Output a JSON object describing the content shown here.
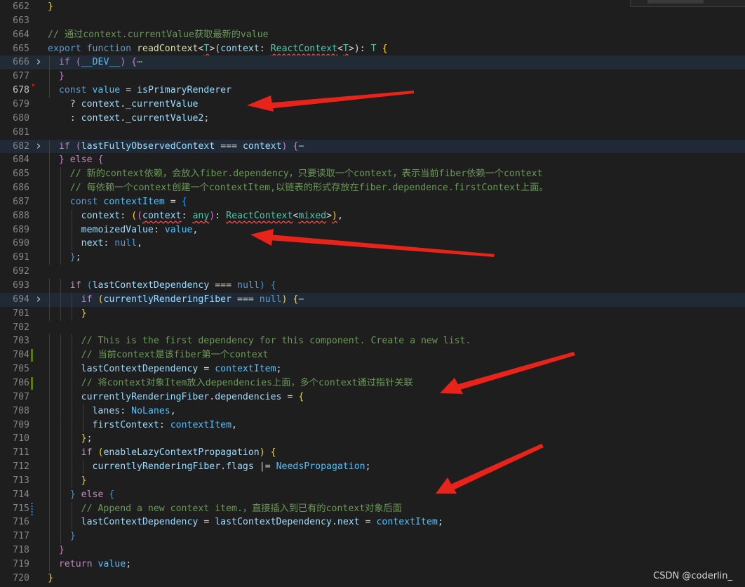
{
  "editor": {
    "lines": [
      {
        "n": "662",
        "tokens": [
          [
            "b1",
            "}"
          ]
        ]
      },
      {
        "n": "663",
        "tokens": []
      },
      {
        "n": "664",
        "tokens": [
          [
            "cmt",
            "// 通过context.currentValue获取最新的value"
          ]
        ]
      },
      {
        "n": "665",
        "tokens": [
          [
            "kw",
            "export"
          ],
          [
            "p",
            " "
          ],
          [
            "kw",
            "function"
          ],
          [
            "p",
            " "
          ],
          [
            "fn",
            "readContext"
          ],
          [
            "p",
            "<"
          ],
          [
            "type",
            "T",
            true
          ],
          [
            "p",
            ">("
          ],
          [
            "var",
            "context"
          ],
          [
            "p",
            ": "
          ],
          [
            "type",
            "ReactContext",
            true
          ],
          [
            "p",
            "<"
          ],
          [
            "type",
            "T",
            true
          ],
          [
            "p",
            ">)"
          ],
          [
            "p",
            ": "
          ],
          [
            "type",
            "T"
          ],
          [
            "p",
            " "
          ],
          [
            "b1",
            "{"
          ]
        ]
      },
      {
        "n": "666",
        "fold": ">",
        "tokens": [
          [
            "p",
            "  "
          ],
          [
            "ctl",
            "if"
          ],
          [
            "p",
            " "
          ],
          [
            "b2",
            "("
          ],
          [
            "const",
            "__DEV__"
          ],
          [
            "b2",
            ")"
          ],
          [
            "p",
            " "
          ],
          [
            "b2",
            "{"
          ],
          [
            "ell",
            "⋯"
          ]
        ]
      },
      {
        "n": "677",
        "tokens": [
          [
            "p",
            "  "
          ],
          [
            "b2",
            "}"
          ]
        ]
      },
      {
        "n": "678",
        "active": true,
        "gutter": "err",
        "tokens": [
          [
            "p",
            "  "
          ],
          [
            "kw",
            "const"
          ],
          [
            "p",
            " "
          ],
          [
            "const",
            "value"
          ],
          [
            "p",
            " = "
          ],
          [
            "var",
            "isPrimaryRenderer"
          ]
        ]
      },
      {
        "n": "679",
        "tokens": [
          [
            "p",
            "    ? "
          ],
          [
            "var",
            "context"
          ],
          [
            "p",
            "."
          ],
          [
            "var",
            "_currentValue"
          ]
        ]
      },
      {
        "n": "680",
        "tokens": [
          [
            "p",
            "    : "
          ],
          [
            "var",
            "context"
          ],
          [
            "p",
            "."
          ],
          [
            "var",
            "_currentValue2"
          ],
          [
            "p",
            ";"
          ]
        ]
      },
      {
        "n": "681",
        "tokens": []
      },
      {
        "n": "682",
        "fold": ">",
        "folded": true,
        "tokens": [
          [
            "p",
            "  "
          ],
          [
            "ctl",
            "if"
          ],
          [
            "p",
            " "
          ],
          [
            "b2",
            "("
          ],
          [
            "var",
            "lastFullyObservedContext"
          ],
          [
            "p",
            " === "
          ],
          [
            "var",
            "context"
          ],
          [
            "b2",
            ")"
          ],
          [
            "p",
            " "
          ],
          [
            "b2",
            "{"
          ],
          [
            "ell",
            "⋯"
          ]
        ]
      },
      {
        "n": "684",
        "tokens": [
          [
            "p",
            "  "
          ],
          [
            "b2",
            "}"
          ],
          [
            "p",
            " "
          ],
          [
            "ctl",
            "else"
          ],
          [
            "p",
            " "
          ],
          [
            "b2",
            "{"
          ]
        ]
      },
      {
        "n": "685",
        "tokens": [
          [
            "p",
            "    "
          ],
          [
            "cmt",
            "// 新的context依赖，会放入fiber.dependency，只要读取一个context，表示当前fiber依赖一个context"
          ]
        ]
      },
      {
        "n": "686",
        "tokens": [
          [
            "p",
            "    "
          ],
          [
            "cmt",
            "// 每依赖一个context创建一个contextItem,以链表的形式存放在fiber.dependence.firstContext上面。"
          ]
        ]
      },
      {
        "n": "687",
        "tokens": [
          [
            "p",
            "    "
          ],
          [
            "kw",
            "const"
          ],
          [
            "p",
            " "
          ],
          [
            "const",
            "contextItem"
          ],
          [
            "p",
            " = "
          ],
          [
            "b3",
            "{"
          ]
        ]
      },
      {
        "n": "688",
        "tokens": [
          [
            "p",
            "      "
          ],
          [
            "var",
            "context"
          ],
          [
            "p",
            ": "
          ],
          [
            "b1",
            "("
          ],
          [
            "b2",
            "("
          ],
          [
            "var",
            "context",
            true
          ],
          [
            "p",
            ": "
          ],
          [
            "type",
            "any",
            true
          ],
          [
            "b2",
            ")"
          ],
          [
            "p",
            ": "
          ],
          [
            "type",
            "ReactContext",
            true
          ],
          [
            "p",
            "<"
          ],
          [
            "type",
            "mixed",
            true
          ],
          [
            "p",
            ">"
          ],
          [
            "b1",
            ")",
            true
          ],
          [
            "p",
            ","
          ]
        ]
      },
      {
        "n": "689",
        "tokens": [
          [
            "p",
            "      "
          ],
          [
            "var",
            "memoizedValue"
          ],
          [
            "p",
            ": "
          ],
          [
            "const",
            "value"
          ],
          [
            "p",
            ","
          ]
        ]
      },
      {
        "n": "690",
        "tokens": [
          [
            "p",
            "      "
          ],
          [
            "var",
            "next"
          ],
          [
            "p",
            ": "
          ],
          [
            "kw",
            "null"
          ],
          [
            "p",
            ","
          ]
        ]
      },
      {
        "n": "691",
        "tokens": [
          [
            "p",
            "    "
          ],
          [
            "b3",
            "}"
          ],
          [
            "p",
            ";"
          ]
        ]
      },
      {
        "n": "692",
        "tokens": []
      },
      {
        "n": "693",
        "tokens": [
          [
            "p",
            "    "
          ],
          [
            "ctl",
            "if"
          ],
          [
            "p",
            " "
          ],
          [
            "b3",
            "("
          ],
          [
            "var",
            "lastContextDependency"
          ],
          [
            "p",
            " === "
          ],
          [
            "kw",
            "null"
          ],
          [
            "b3",
            ")"
          ],
          [
            "p",
            " "
          ],
          [
            "b3",
            "{"
          ]
        ]
      },
      {
        "n": "694",
        "fold": ">",
        "folded": true,
        "tokens": [
          [
            "p",
            "      "
          ],
          [
            "ctl",
            "if"
          ],
          [
            "p",
            " "
          ],
          [
            "b1",
            "("
          ],
          [
            "var",
            "currentlyRenderingFiber"
          ],
          [
            "p",
            " === "
          ],
          [
            "kw",
            "null"
          ],
          [
            "b1",
            ")"
          ],
          [
            "p",
            " "
          ],
          [
            "b1",
            "{"
          ],
          [
            "ell",
            "⋯"
          ]
        ]
      },
      {
        "n": "701",
        "tokens": [
          [
            "p",
            "      "
          ],
          [
            "b1",
            "}"
          ]
        ]
      },
      {
        "n": "702",
        "tokens": []
      },
      {
        "n": "703",
        "tokens": [
          [
            "p",
            "      "
          ],
          [
            "cmt",
            "// This is the first dependency for this component. Create a new list."
          ]
        ]
      },
      {
        "n": "704",
        "gutter": "add",
        "tokens": [
          [
            "p",
            "      "
          ],
          [
            "cmt",
            "// 当前context是该fiber第一个context"
          ]
        ]
      },
      {
        "n": "705",
        "tokens": [
          [
            "p",
            "      "
          ],
          [
            "var",
            "lastContextDependency"
          ],
          [
            "p",
            " = "
          ],
          [
            "const",
            "contextItem"
          ],
          [
            "p",
            ";"
          ]
        ]
      },
      {
        "n": "706",
        "gutter": "add",
        "tokens": [
          [
            "p",
            "      "
          ],
          [
            "cmt",
            "// 将context对象Item放入dependencies上面，多个context通过指针关联"
          ]
        ]
      },
      {
        "n": "707",
        "tokens": [
          [
            "p",
            "      "
          ],
          [
            "var",
            "currentlyRenderingFiber"
          ],
          [
            "p",
            "."
          ],
          [
            "var",
            "dependencies"
          ],
          [
            "p",
            " = "
          ],
          [
            "b1",
            "{"
          ]
        ]
      },
      {
        "n": "708",
        "tokens": [
          [
            "p",
            "        "
          ],
          [
            "var",
            "lanes"
          ],
          [
            "p",
            ": "
          ],
          [
            "const",
            "NoLanes"
          ],
          [
            "p",
            ","
          ]
        ]
      },
      {
        "n": "709",
        "tokens": [
          [
            "p",
            "        "
          ],
          [
            "var",
            "firstContext"
          ],
          [
            "p",
            ": "
          ],
          [
            "const",
            "contextItem"
          ],
          [
            "p",
            ","
          ]
        ]
      },
      {
        "n": "710",
        "tokens": [
          [
            "p",
            "      "
          ],
          [
            "b1",
            "}"
          ],
          [
            "p",
            ";"
          ]
        ]
      },
      {
        "n": "711",
        "tokens": [
          [
            "p",
            "      "
          ],
          [
            "ctl",
            "if"
          ],
          [
            "p",
            " "
          ],
          [
            "b1",
            "("
          ],
          [
            "var",
            "enableLazyContextPropagation"
          ],
          [
            "b1",
            ")"
          ],
          [
            "p",
            " "
          ],
          [
            "b1",
            "{"
          ]
        ]
      },
      {
        "n": "712",
        "tokens": [
          [
            "p",
            "        "
          ],
          [
            "var",
            "currentlyRenderingFiber"
          ],
          [
            "p",
            "."
          ],
          [
            "var",
            "flags"
          ],
          [
            "p",
            " |= "
          ],
          [
            "const",
            "NeedsPropagation"
          ],
          [
            "p",
            ";"
          ]
        ]
      },
      {
        "n": "713",
        "tokens": [
          [
            "p",
            "      "
          ],
          [
            "b1",
            "}"
          ]
        ]
      },
      {
        "n": "714",
        "tokens": [
          [
            "p",
            "    "
          ],
          [
            "b3",
            "}"
          ],
          [
            "p",
            " "
          ],
          [
            "ctl",
            "else"
          ],
          [
            "p",
            " "
          ],
          [
            "b3",
            "{"
          ]
        ]
      },
      {
        "n": "715",
        "gutter": "mod",
        "tokens": [
          [
            "p",
            "      "
          ],
          [
            "cmt",
            "// Append a new context item.，直接插入到已有的context对象后面"
          ]
        ]
      },
      {
        "n": "716",
        "tokens": [
          [
            "p",
            "      "
          ],
          [
            "var",
            "lastContextDependency"
          ],
          [
            "p",
            " = "
          ],
          [
            "var",
            "lastContextDependency"
          ],
          [
            "p",
            "."
          ],
          [
            "var",
            "next"
          ],
          [
            "p",
            " = "
          ],
          [
            "const",
            "contextItem"
          ],
          [
            "p",
            ";"
          ]
        ]
      },
      {
        "n": "717",
        "tokens": [
          [
            "p",
            "    "
          ],
          [
            "b3",
            "}"
          ]
        ]
      },
      {
        "n": "718",
        "tokens": [
          [
            "p",
            "  "
          ],
          [
            "b2",
            "}"
          ]
        ]
      },
      {
        "n": "719",
        "tokens": [
          [
            "p",
            "  "
          ],
          [
            "ctl",
            "return"
          ],
          [
            "p",
            " "
          ],
          [
            "const",
            "value"
          ],
          [
            "p",
            ";"
          ]
        ]
      },
      {
        "n": "720",
        "tokens": [
          [
            "b1",
            "}"
          ]
        ]
      }
    ]
  },
  "watermark": "CSDN @coderlin_",
  "colors": {
    "background": "#1e1e1e",
    "annotation_arrow": "#e8231a"
  }
}
